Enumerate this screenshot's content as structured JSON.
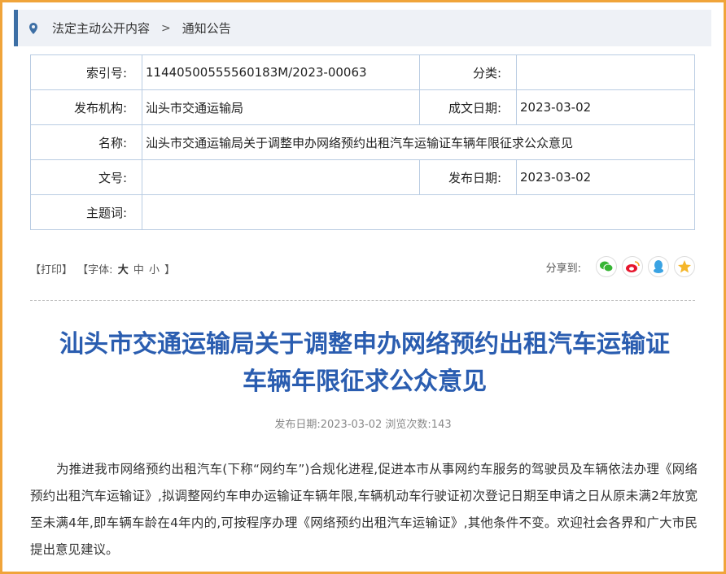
{
  "breadcrumb": {
    "item1": "法定主动公开内容",
    "separator": ">",
    "item2": "通知公告"
  },
  "meta": {
    "index_label": "索引号:",
    "index_value": "11440500555560183M/2023-00063",
    "category_label": "分类:",
    "category_value": "",
    "publisher_label": "发布机构:",
    "publisher_value": "汕头市交通运输局",
    "created_label": "成文日期:",
    "created_value": "2023-03-02",
    "name_label": "名称:",
    "name_value": "汕头市交通运输局关于调整申办网络预约出租汽车运输证车辆年限征求公众意见",
    "docno_label": "文号:",
    "docno_value": "",
    "pubdate_label": "发布日期:",
    "pubdate_value": "2023-03-02",
    "keywords_label": "主题词:",
    "keywords_value": ""
  },
  "tools": {
    "print": "【打印】",
    "font_prefix": "【字体:",
    "font_large": "大",
    "font_medium": "中",
    "font_small": "小",
    "font_suffix": "】",
    "share_label": "分享到:"
  },
  "share_icons": [
    "wechat-icon",
    "weibo-icon",
    "qq-icon",
    "qzone-icon"
  ],
  "article": {
    "title_line1": "汕头市交通运输局关于调整申办网络预约出租汽车运输证",
    "title_line2": "车辆年限征求公众意见",
    "info": "发布日期:2023-03-02 浏览次数:143",
    "body": "为推进我市网络预约出租汽车(下称“网约车”)合规化进程,促进本市从事网约车服务的驾驶员及车辆依法办理《网络预约出租汽车运输证》,拟调整网约车申办运输证车辆年限,车辆机动车行驶证初次登记日期至申请之日从原未满2年放宽至未满4年,即车辆车龄在4年内的,可按程序办理《网络预约出租汽车运输证》,其他条件不变。欢迎社会各界和广大市民提出意见建议。"
  },
  "colors": {
    "frame": "#f0a43a",
    "accent": "#2a5db0",
    "crumb_bg": "#eef1f6",
    "border": "#b9cce2"
  }
}
